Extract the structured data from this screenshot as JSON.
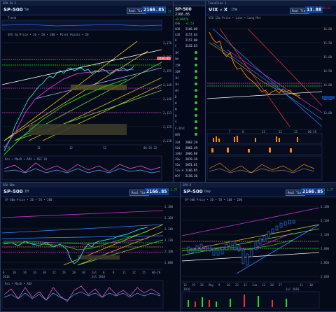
{
  "panels": {
    "p1": {
      "title": "SPX 5m 5",
      "symbol": "SP-500",
      "timeframe": "5m",
      "realtime": "Real Time",
      "price": "2166.85",
      "change": "+ 1.77",
      "subtitle": "Trend",
      "legend": "SPX 5m Price  • 20  • 50  • 200  • Pivot Points  • 20",
      "xlabels": [
        "7/15",
        "11",
        "12",
        "13",
        "06-22-22"
      ],
      "indicator_legend": "Rsi  • MacD  • ADX  • RSI 14"
    },
    "p2": {
      "title": "Trendline 1",
      "symbol": "VIX – X",
      "timeframe": "15m",
      "realtime": "Real Time",
      "price": "13.88",
      "change": "+0.32",
      "xlabels": [
        "7",
        "8",
        "11",
        "12",
        "13",
        "06-19"
      ],
      "legend": "VIX 15m Price  • Line  • Long Mvt"
    },
    "p3": {
      "title": "SPX 60m",
      "symbol": "SP-500",
      "timeframe": "1H",
      "realtime": "Real Time",
      "price": "2166.85",
      "change": "+ 1.77",
      "legend": "SP 60m Price  • 20  • 50  • 200",
      "xlabels": [
        "6",
        "10",
        "14",
        "16",
        "20",
        "22",
        "24",
        "28",
        "30",
        "Jul",
        "6",
        "8",
        "11",
        "12",
        "15",
        "06-29"
      ],
      "xsub": "2016",
      "jul": "Jul 2016",
      "indicator_legend": "Rsi  • MacD  • ADX"
    },
    "p4": {
      "title": "SPX D",
      "symbol": "SP-500",
      "timeframe": "Day",
      "realtime": "Real Time",
      "price": "2166.85",
      "change": "+ 1.77",
      "legend": "SP-500 Price  • 20  • 50  • 100  • 200",
      "xlabels": [
        "12",
        "19",
        "26",
        "May",
        "9",
        "16",
        "23",
        "31",
        "Jun",
        "13",
        "20",
        "27",
        "Jul 2016",
        "11",
        "18"
      ],
      "xsub": "2016"
    }
  },
  "quote": {
    "symbol": "SP-500",
    "price": "2166.85",
    "pct": "+0.0927%",
    "chg_label": "CHG",
    "chg": "+1.53",
    "rows": [
      {
        "label": "HOD",
        "value": "2166.00"
      },
      {
        "label": "LOD",
        "value": "2157.63"
      },
      {
        "label": "O",
        "value": "2157.00"
      },
      {
        "label": "C",
        "value": "2152.63"
      }
    ],
    "signals": [
      {
        "label": "1M"
      },
      {
        "label": "5M"
      },
      {
        "label": "15M"
      },
      {
        "label": "30M"
      },
      {
        "label": "1H"
      },
      {
        "label": "2H"
      },
      {
        "label": "4H"
      },
      {
        "label": "D"
      },
      {
        "label": "W"
      },
      {
        "label": "M"
      },
      {
        "label": "Q"
      },
      {
        "label": "Y"
      },
      {
        "label": "C-IV/C"
      },
      {
        "label": "OBV"
      }
    ],
    "mas": [
      {
        "label": "20d",
        "value": "2082.29"
      },
      {
        "label": "50d",
        "value": "2082.49"
      },
      {
        "label": "100d",
        "value": "2066.88"
      },
      {
        "label": "20w",
        "value": "2070.36"
      },
      {
        "label": "50w",
        "value": "2051.81"
      },
      {
        "label": "52w H",
        "value": "2166.85"
      },
      {
        "label": "HOY",
        "value": "2156.30"
      }
    ]
  },
  "colors": {
    "up": "#22dd22",
    "down": "#ee3333",
    "bg": "#050a18"
  }
}
